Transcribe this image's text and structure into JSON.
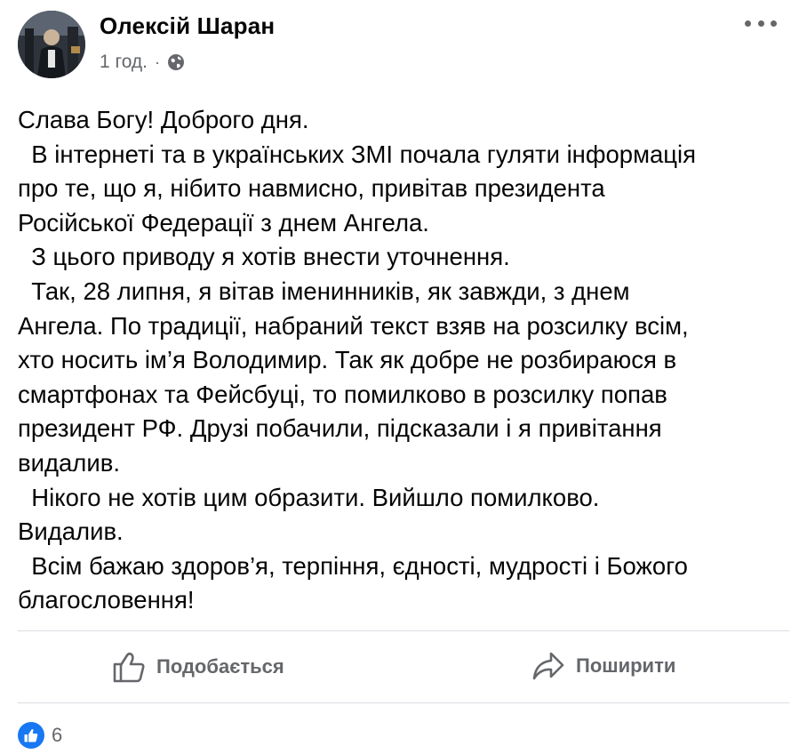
{
  "post": {
    "author": "Олексій Шаран",
    "time": "1 год.",
    "separator": "·",
    "privacy_icon": "globe-icon",
    "more_icon": "more-options-icon",
    "lines": [
      "Слава Богу! Доброго дня.",
      "  В інтернеті та в українських ЗМІ почала гуляти інформація",
      "про те, що я, нібито навмисно, привітав президента",
      "Російської Федерації з днем Ангела.",
      "  З цього приводу я хотів внести уточнення.",
      "  Так, 28 липня, я вітав іменинників, як завжди, з днем",
      "Ангела. По традиції, набраний текст взяв на розсилку всім,",
      "хто носить ім’я Володимир. Так як добре не розбираюся в",
      "смартфонах та Фейсбуці, то помилково в розсилку попав",
      "президент РФ. Друзі побачили, підсказали і я привітання",
      "видалив.",
      "  Нікого не хотів цим образити. Вийшло помилково.",
      "Видалив.",
      "  Всім бажаю здоров’я, терпіння, єдності, мудрості і Божого",
      "благословення!"
    ]
  },
  "actions": {
    "like_label": "Подобається",
    "share_label": "Поширити"
  },
  "reactions": {
    "count": "6",
    "icon": "thumbs-up-reaction-icon"
  },
  "colors": {
    "accent": "#1877f2",
    "secondary_text": "#65676b",
    "divider": "#dadde1"
  }
}
